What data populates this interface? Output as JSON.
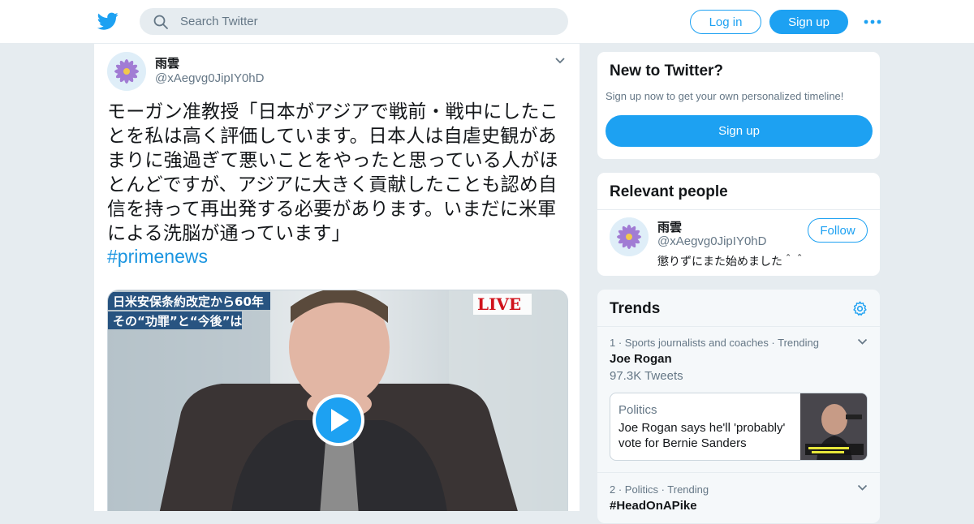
{
  "header": {
    "search_placeholder": "Search Twitter",
    "login_label": "Log in",
    "signup_label": "Sign up",
    "more_icon": "more-icon",
    "brand_color": "#1da1f2"
  },
  "tweet": {
    "user_name": "雨雲",
    "handle": "@xAegvg0JipIY0hD",
    "text": "モーガン准教授「日本がアジアで戦前・戦中にしたことを私は高く評価しています。日本人は自虐史観があまりに強過ぎて悪いことをやったと思っている人がほとんどですが、アジアに大きく貢献したことも認め自信を持って再出発する必要があります。いまだに米軍による洗脳が通っています」",
    "hashtag": "#primenews",
    "video": {
      "caption_line1": "日米安保条約改定から60年",
      "caption_line2": "その“功罪”と“今後”は",
      "live_label": "LIVE",
      "play_icon": "play-icon"
    }
  },
  "new_to_twitter": {
    "title": "New to Twitter?",
    "subtitle": "Sign up now to get your own personalized timeline!",
    "button_label": "Sign up"
  },
  "relevant_people": {
    "title": "Relevant people",
    "person": {
      "name": "雨雲",
      "handle": "@xAegvg0JipIY0hD",
      "bio": "懲りずにまた始めました＾＾",
      "follow_label": "Follow"
    }
  },
  "trends": {
    "title": "Trends",
    "items": [
      {
        "meta": "1 · Sports journalists and coaches · Trending",
        "name": "Joe Rogan",
        "count": "97.3K Tweets",
        "story": {
          "category": "Politics",
          "headline": "Joe Rogan says he'll 'probably' vote for Bernie Sanders"
        }
      },
      {
        "meta": "2 · Politics · Trending",
        "name": "#HeadOnAPike"
      }
    ]
  }
}
